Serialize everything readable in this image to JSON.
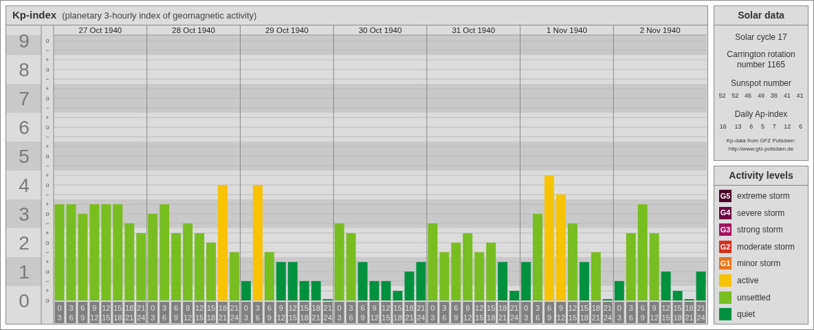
{
  "header": {
    "title": "Kp-index",
    "subtitle": "(planetary 3-hourly index of geomagnetic activity)"
  },
  "kp_chart": {
    "minor_ticks": [
      "o",
      "−",
      "+",
      "o",
      "−",
      "+",
      "o",
      "−",
      "+",
      "o",
      "−",
      "+",
      "o",
      "−",
      "+",
      "o",
      "−",
      "+",
      "o",
      "−",
      "+",
      "o",
      "−",
      "+",
      "o",
      "−",
      "+",
      "o"
    ],
    "days": [
      {
        "date": "27 Oct 1940",
        "slots": [
          [
            "0",
            "3"
          ],
          [
            "3",
            "6"
          ],
          [
            "6",
            "9"
          ],
          [
            "9",
            "12"
          ],
          [
            "12",
            "15"
          ],
          [
            "15",
            "18"
          ],
          [
            "18",
            "21"
          ],
          [
            "21",
            "24"
          ]
        ]
      },
      {
        "date": "28 Oct 1940",
        "slots": [
          [
            "0",
            "3"
          ],
          [
            "3",
            "6"
          ],
          [
            "6",
            "9"
          ],
          [
            "9",
            "12"
          ],
          [
            "12",
            "15"
          ],
          [
            "15",
            "18"
          ],
          [
            "18",
            "21"
          ],
          [
            "21",
            "24"
          ]
        ]
      },
      {
        "date": "29 Oct 1940",
        "slots": [
          [
            "0",
            "3"
          ],
          [
            "3",
            "6"
          ],
          [
            "6",
            "9"
          ],
          [
            "9",
            "12"
          ],
          [
            "12",
            "15"
          ],
          [
            "15",
            "18"
          ],
          [
            "18",
            "21"
          ],
          [
            "21",
            "24"
          ]
        ]
      },
      {
        "date": "30 Oct 1940",
        "slots": [
          [
            "0",
            "3"
          ],
          [
            "3",
            "6"
          ],
          [
            "6",
            "9"
          ],
          [
            "9",
            "12"
          ],
          [
            "12",
            "15"
          ],
          [
            "15",
            "18"
          ],
          [
            "18",
            "21"
          ],
          [
            "21",
            "24"
          ]
        ]
      },
      {
        "date": "31 Oct 1940",
        "slots": [
          [
            "0",
            "3"
          ],
          [
            "3",
            "6"
          ],
          [
            "6",
            "9"
          ],
          [
            "9",
            "12"
          ],
          [
            "12",
            "15"
          ],
          [
            "15",
            "18"
          ],
          [
            "18",
            "21"
          ],
          [
            "21",
            "24"
          ]
        ]
      },
      {
        "date": "1 Nov 1940",
        "slots": [
          [
            "0",
            "3"
          ],
          [
            "3",
            "6"
          ],
          [
            "6",
            "9"
          ],
          [
            "9",
            "12"
          ],
          [
            "12",
            "15"
          ],
          [
            "15",
            "18"
          ],
          [
            "18",
            "21"
          ],
          [
            "21",
            "24"
          ]
        ]
      },
      {
        "date": "2 Nov 1940",
        "slots": [
          [
            "0",
            "3"
          ],
          [
            "3",
            "6"
          ],
          [
            "6",
            "9"
          ],
          [
            "9",
            "12"
          ],
          [
            "12",
            "15"
          ],
          [
            "15",
            "18"
          ],
          [
            "18",
            "21"
          ],
          [
            "21",
            "24"
          ]
        ]
      }
    ],
    "chart_data": {
      "type": "bar",
      "ylim": [
        0,
        9
      ],
      "yticks": [
        0,
        1,
        2,
        3,
        4,
        5,
        6,
        7,
        8,
        9
      ],
      "grid": true,
      "series": [
        {
          "color": "#f8c300",
          "values": [
            null,
            null,
            null,
            null,
            null,
            null,
            null,
            null,
            null,
            null,
            null,
            null,
            null,
            null,
            4,
            null,
            null,
            4,
            null,
            null,
            null,
            null,
            null,
            null,
            null,
            null,
            null,
            null,
            null,
            null,
            null,
            null,
            null,
            null,
            null,
            null,
            null,
            null,
            null,
            null,
            null,
            null,
            4.33,
            3.67,
            null,
            null,
            null,
            null,
            null,
            null,
            null,
            null,
            null,
            null,
            null,
            null
          ]
        },
        {
          "color": "#78be20",
          "values": [
            3.33,
            3.33,
            3,
            3.33,
            3.33,
            3.33,
            2.67,
            2.33,
            3,
            3.33,
            2.33,
            2.67,
            2.33,
            2,
            null,
            1.67,
            null,
            null,
            1.67,
            null,
            null,
            null,
            null,
            null,
            2.67,
            2.33,
            null,
            null,
            null,
            null,
            null,
            null,
            2.67,
            1.67,
            2,
            2.33,
            1.67,
            2,
            null,
            null,
            null,
            3,
            null,
            null,
            2.67,
            null,
            1.67,
            null,
            null,
            2.33,
            3.33,
            2.33,
            null,
            null,
            null,
            null
          ]
        },
        {
          "color": "#00913f",
          "values": [
            null,
            null,
            null,
            null,
            null,
            null,
            null,
            null,
            null,
            null,
            null,
            null,
            null,
            null,
            null,
            null,
            0.67,
            null,
            null,
            1.33,
            1.33,
            0.67,
            0.67,
            0,
            null,
            null,
            1.33,
            0.67,
            0.67,
            0.33,
            1,
            1.33,
            null,
            null,
            null,
            null,
            null,
            null,
            1.33,
            0.33,
            1.33,
            null,
            null,
            null,
            null,
            1.33,
            null,
            0,
            0.67,
            null,
            null,
            null,
            1,
            0.33,
            0,
            1
          ]
        }
      ]
    }
  },
  "solar_data": {
    "title": "Solar data",
    "cycle": "Solar cycle 17",
    "rotation": "Carrington rotation number 1165",
    "sunspot_title": "Sunspot number",
    "sunspots": [
      "52",
      "52",
      "46",
      "49",
      "38",
      "41",
      "41"
    ],
    "ap_title": "Daily Ap-index",
    "ap_values": [
      "16",
      "13",
      "6",
      "5",
      "7",
      "12",
      "6"
    ],
    "credit": "Kp-data from GFZ Potsdam:",
    "credit_url": "http://www.gfz-potsdam.de"
  },
  "activity_levels": {
    "title": "Activity levels",
    "items": [
      {
        "badge": "G5",
        "label": "extreme storm",
        "color": "#4b0028"
      },
      {
        "badge": "G4",
        "label": "severe storm",
        "color": "#6e0040"
      },
      {
        "badge": "G3",
        "label": "strong storm",
        "color": "#a5115e"
      },
      {
        "badge": "G2",
        "label": "moderate storm",
        "color": "#d62d1e"
      },
      {
        "badge": "G1",
        "label": "minor storm",
        "color": "#e8741b"
      },
      {
        "label": "active",
        "color": "#f8c300"
      },
      {
        "label": "unsettled",
        "color": "#78be20"
      },
      {
        "label": "quiet",
        "color": "#00913f"
      }
    ]
  }
}
